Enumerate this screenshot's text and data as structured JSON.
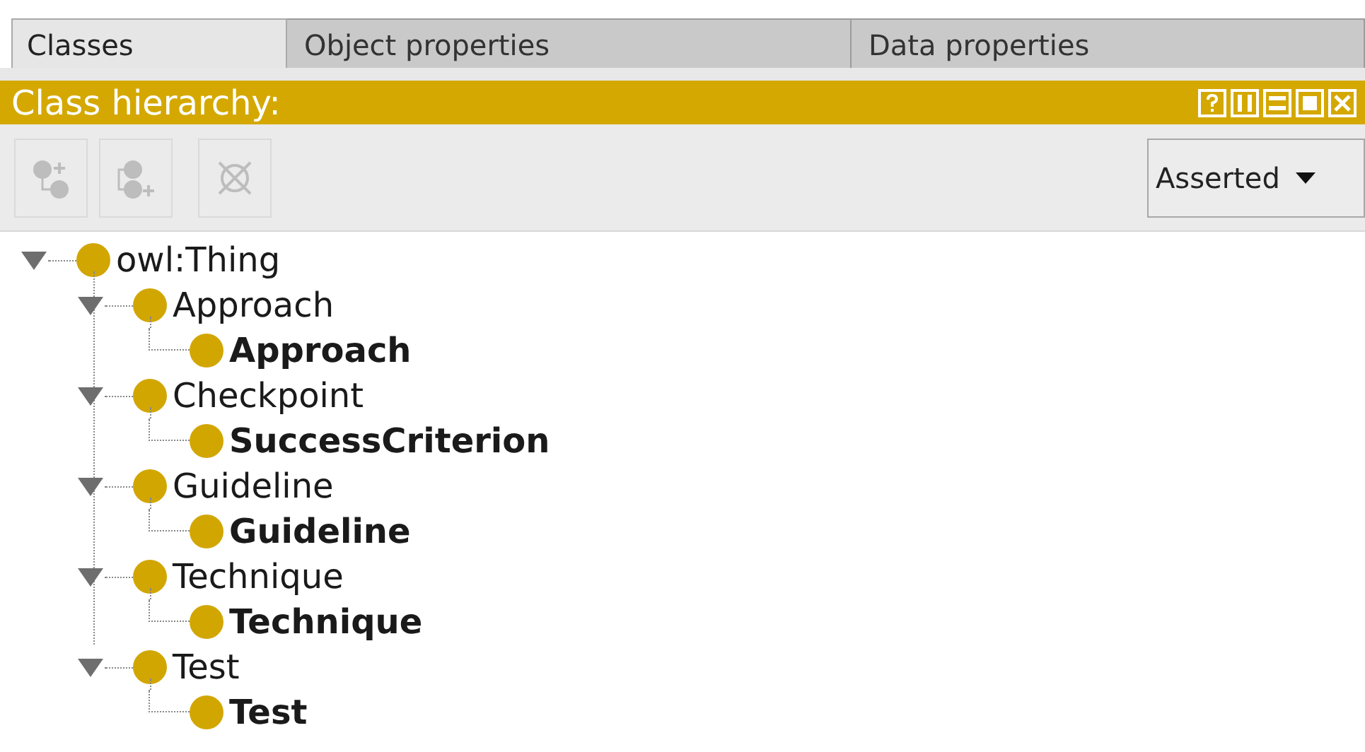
{
  "tabs": [
    {
      "label": "Classes",
      "selected": true
    },
    {
      "label": "Object properties",
      "selected": false
    },
    {
      "label": "Data properties",
      "selected": false
    }
  ],
  "panel": {
    "title": "Class hierarchy:"
  },
  "toolbar": [
    {
      "kind": "add-subclass",
      "disabled": true
    },
    {
      "kind": "add-sibling",
      "disabled": true
    },
    {
      "kind": "delete",
      "disabled": true
    }
  ],
  "view_dropdown": {
    "value": "Asserted"
  },
  "tree": [
    {
      "label": "owl:Thing",
      "bold": false,
      "expanded": true,
      "children": [
        {
          "label": "Approach",
          "bold": false,
          "expanded": true,
          "children": [
            {
              "label": "Approach",
              "bold": true
            }
          ]
        },
        {
          "label": "Checkpoint",
          "bold": false,
          "expanded": true,
          "children": [
            {
              "label": "SuccessCriterion",
              "bold": true
            }
          ]
        },
        {
          "label": "Guideline",
          "bold": false,
          "expanded": true,
          "children": [
            {
              "label": "Guideline",
              "bold": true
            }
          ]
        },
        {
          "label": "Technique",
          "bold": false,
          "expanded": true,
          "children": [
            {
              "label": "Technique",
              "bold": true
            }
          ]
        },
        {
          "label": "Test",
          "bold": false,
          "expanded": true,
          "children": [
            {
              "label": "Test",
              "bold": true
            }
          ]
        }
      ]
    }
  ]
}
